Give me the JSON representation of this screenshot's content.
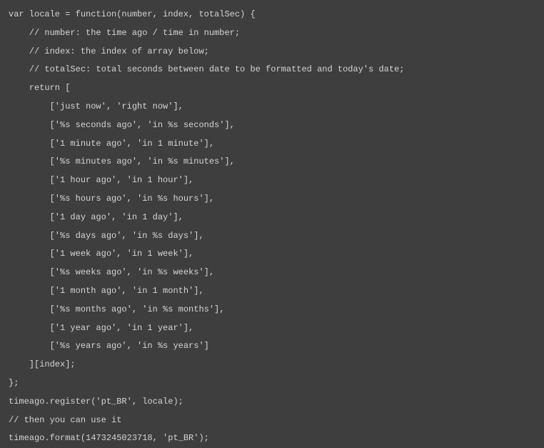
{
  "code": {
    "lines": [
      "var locale = function(number, index, totalSec) {",
      "    // number: the time ago / time in number;",
      "    // index: the index of array below;",
      "    // totalSec: total seconds between date to be formatted and today's date;",
      "    return [",
      "        ['just now', 'right now'],",
      "        ['%s seconds ago', 'in %s seconds'],",
      "        ['1 minute ago', 'in 1 minute'],",
      "        ['%s minutes ago', 'in %s minutes'],",
      "        ['1 hour ago', 'in 1 hour'],",
      "        ['%s hours ago', 'in %s hours'],",
      "        ['1 day ago', 'in 1 day'],",
      "        ['%s days ago', 'in %s days'],",
      "        ['1 week ago', 'in 1 week'],",
      "        ['%s weeks ago', 'in %s weeks'],",
      "        ['1 month ago', 'in 1 month'],",
      "        ['%s months ago', 'in %s months'],",
      "        ['1 year ago', 'in 1 year'],",
      "        ['%s years ago', 'in %s years']",
      "    ][index];",
      "};",
      "timeago.register('pt_BR', locale);",
      "// then you can use it",
      "timeago.format(1473245023718, 'pt_BR');"
    ]
  }
}
